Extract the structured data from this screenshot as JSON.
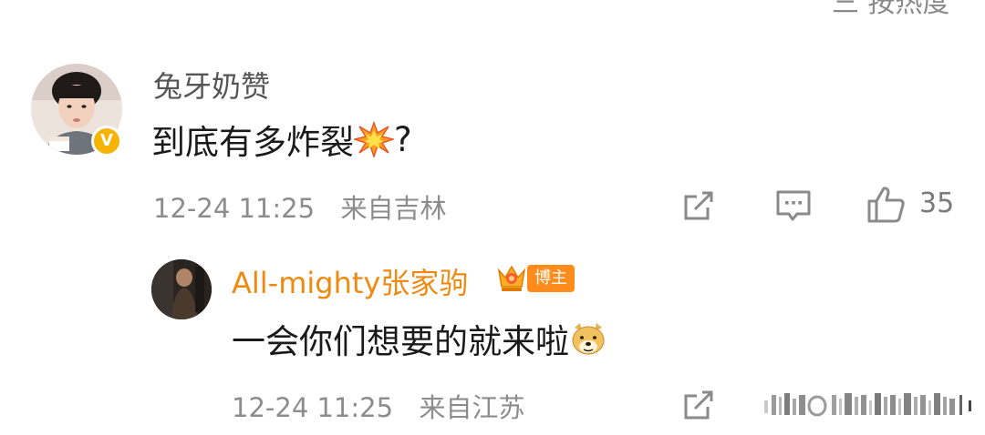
{
  "sort": {
    "label": "三 按热度"
  },
  "comment": {
    "username": "兔牙奶赞",
    "text": "到底有多炸裂",
    "emoji": "explosion-emoji",
    "text_suffix": "?",
    "date": "12-24 11:25",
    "location": "来自吉林",
    "likes": "35",
    "verified_color": "#f6b400"
  },
  "reply": {
    "username": "All-mighty张家驹",
    "author_tag": "博主",
    "text": "一会你们想要的就来啦",
    "emoji": "doge-emoji",
    "date": "12-24 11:25",
    "location": "来自江苏",
    "username_color": "#ef8a11"
  },
  "icons": {
    "share": "share-icon",
    "comment": "comment-icon",
    "like": "thumbs-up-icon"
  }
}
